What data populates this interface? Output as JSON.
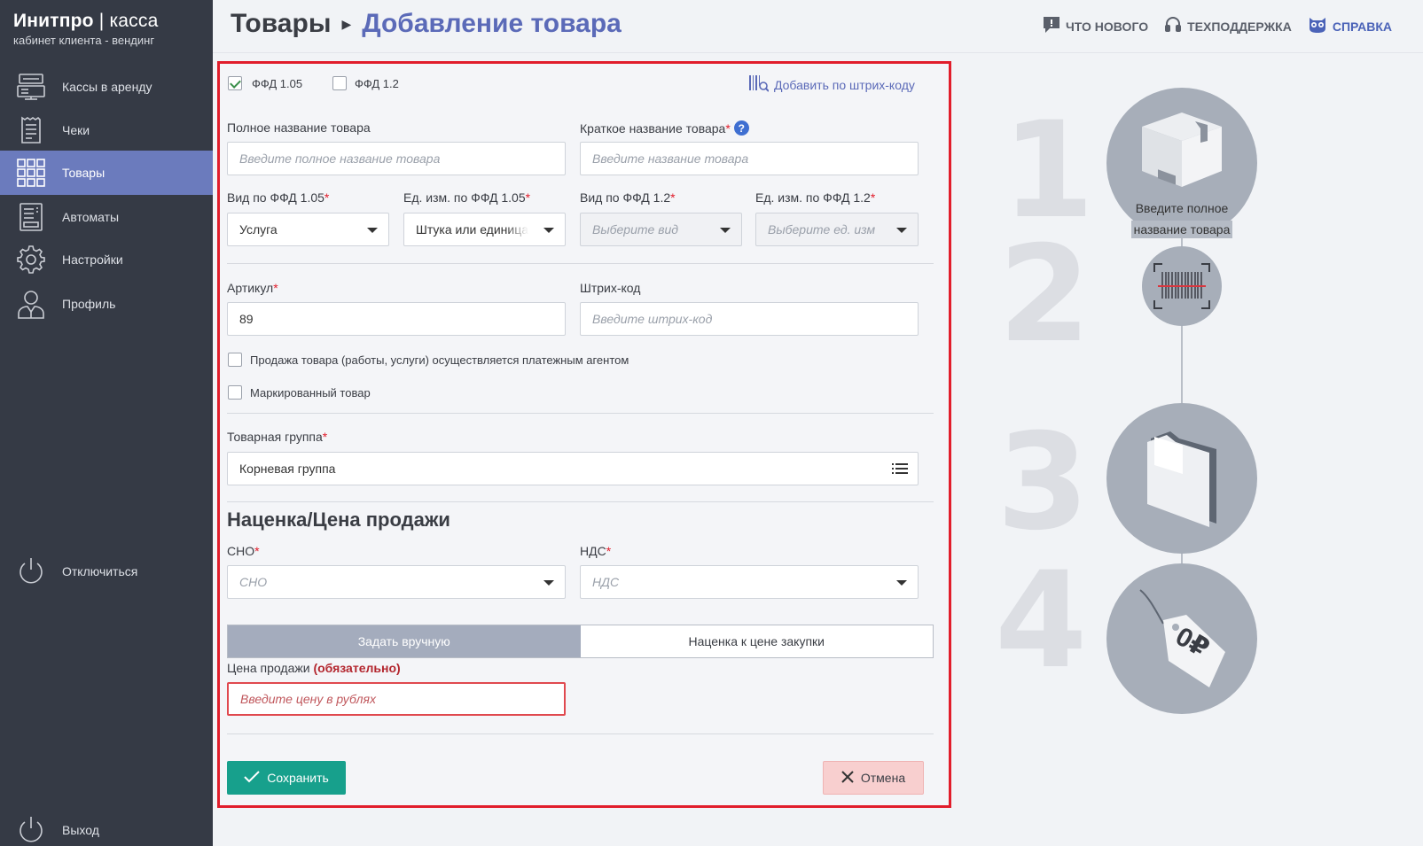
{
  "brand": {
    "name_bold": "Инитпро",
    "name_sep": " | ",
    "name_thin": "касса",
    "subtitle": "кабинет клиента - вендинг"
  },
  "sidebar": {
    "items": [
      {
        "label": "Кассы в аренду",
        "icon": "cash-register-icon"
      },
      {
        "label": "Чеки",
        "icon": "receipt-icon"
      },
      {
        "label": "Товары",
        "icon": "grid-icon",
        "active": true
      },
      {
        "label": "Автоматы",
        "icon": "vending-machine-icon"
      },
      {
        "label": "Настройки",
        "icon": "gear-icon"
      },
      {
        "label": "Профиль",
        "icon": "user-icon"
      }
    ],
    "disconnect_label": "Отключиться",
    "logout_label": "Выход"
  },
  "header": {
    "crumb_root": "Товары",
    "crumb_current": "Добавление товара",
    "whats_new": "ЧТО НОВОГО",
    "support": "ТЕХПОДДЕРЖКА",
    "help": "СПРАВКА"
  },
  "form": {
    "ffd105_label": "ФФД 1.05",
    "ffd12_label": "ФФД 1.2",
    "ffd105_checked": true,
    "ffd12_checked": false,
    "barcode_add_link": "Добавить по штрих-коду",
    "full_name_label": "Полное название товара",
    "full_name_placeholder": "Введите полное название товара",
    "short_name_label": "Краткое название товара",
    "short_name_placeholder": "Введите название товара",
    "kind105_label": "Вид по ФФД 1.05",
    "kind105_value": "Услуга",
    "unit105_label": "Ед. изм. по ФФД 1.05",
    "unit105_value": "Штука или единица",
    "kind12_label": "Вид по ФФД 1.2",
    "kind12_placeholder": "Выберите вид",
    "unit12_label": "Ед. изм. по ФФД 1.2",
    "unit12_placeholder": "Выберите ед. изм",
    "article_label": "Артикул",
    "article_value": "89",
    "barcode_label": "Штрих-код",
    "barcode_placeholder": "Введите штрих-код",
    "agent_checkbox_label": "Продажа товара (работы, услуги) осуществляется платежным агентом",
    "marked_checkbox_label": "Маркированный товар",
    "group_label": "Товарная группа",
    "group_value": "Корневая группа",
    "pricing_title": "Наценка/Цена продажи",
    "sno_label": "СНО",
    "sno_placeholder": "СНО",
    "vat_label": "НДС",
    "vat_placeholder": "НДС",
    "mode_manual": "Задать вручную",
    "mode_markup": "Наценка к цене закупки",
    "price_label": "Цена продажи",
    "price_required_note": "(обязательно)",
    "price_placeholder": "Введите цену в рублях",
    "save_label": "Сохранить",
    "cancel_label": "Отмена",
    "required_mark": "*"
  },
  "steps": {
    "numbers": [
      "1",
      "2",
      "3",
      "4"
    ],
    "step1_hint_line1": "Введите полное",
    "step1_hint_line2": "название товара",
    "price_tag_text": "0₽"
  },
  "colors": {
    "sidebar_bg": "#353a45",
    "active_nav": "#6b7bbd",
    "accent_blue": "#5b6ab8",
    "error_red": "#e11d2b",
    "save_green": "#17a08c"
  }
}
